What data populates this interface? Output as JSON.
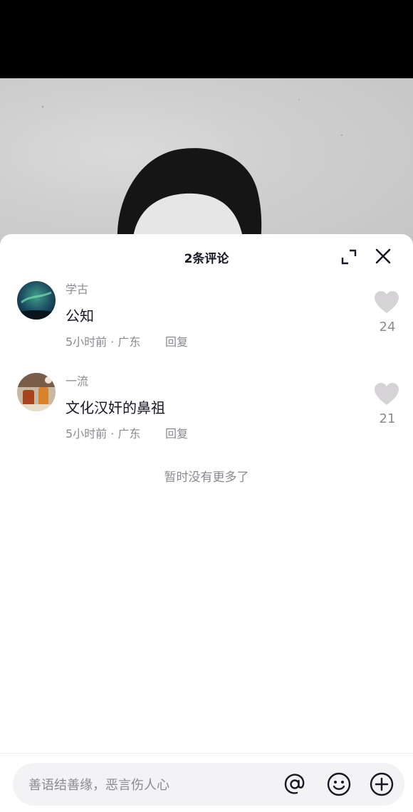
{
  "sheet": {
    "title": "2条评论"
  },
  "comments": [
    {
      "username": "学古",
      "text": "公知",
      "meta": "5小时前 · 广东",
      "reply_label": "回复",
      "likes": "24"
    },
    {
      "username": "一流",
      "text": "文化汉奸的鼻祖",
      "meta": "5小时前 · 广东",
      "reply_label": "回复",
      "likes": "21"
    }
  ],
  "footer_text": "暂时没有更多了",
  "input": {
    "placeholder": "善语结善缘，恶言伤人心"
  },
  "icons": {
    "expand": "expand-icon",
    "close": "close-icon",
    "like": "heart-icon",
    "mention": "at-icon",
    "emoji": "emoji-icon",
    "add": "plus-circle-icon"
  },
  "colors": {
    "primary_text": "#161823",
    "secondary_text": "#8a8b91",
    "like_inactive": "#d6d3d6",
    "input_bg": "#f3f2f5"
  }
}
